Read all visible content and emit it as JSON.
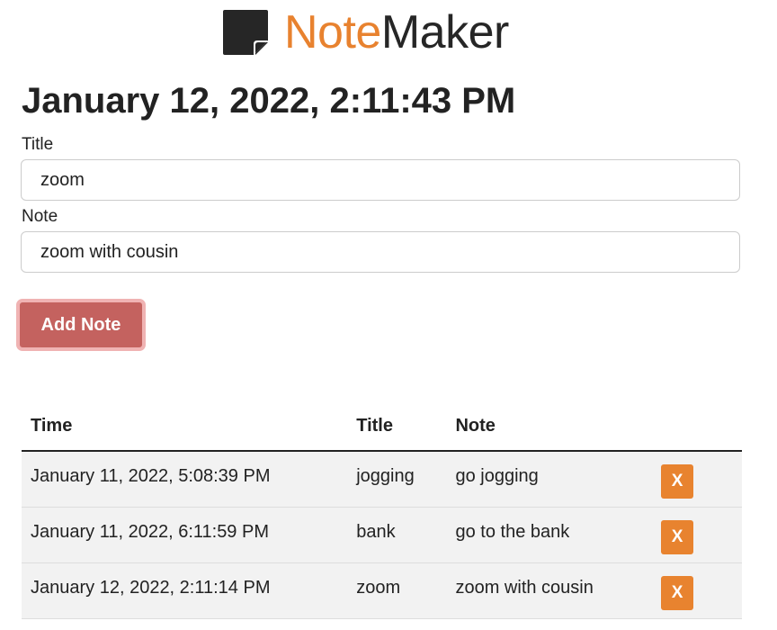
{
  "header": {
    "logo_accent": "Note",
    "logo_main": "Maker",
    "logo_icon": "sticky-note-icon",
    "accent_color": "#e8822f"
  },
  "current_datetime": "January 12, 2022, 2:11:43 PM",
  "form": {
    "title_label": "Title",
    "title_value": "zoom",
    "note_label": "Note",
    "note_value": "zoom with cousin",
    "add_button_label": "Add Note",
    "add_button_color": "#c4625f"
  },
  "table": {
    "headers": {
      "time": "Time",
      "title": "Title",
      "note": "Note"
    },
    "rows": [
      {
        "time": "January 11, 2022, 5:08:39 PM",
        "title": "jogging",
        "note": "go jogging",
        "delete_label": "X"
      },
      {
        "time": "January 11, 2022, 6:11:59 PM",
        "title": "bank",
        "note": "go to the bank",
        "delete_label": "X"
      },
      {
        "time": "January 12, 2022, 2:11:14 PM",
        "title": "zoom",
        "note": "zoom with cousin",
        "delete_label": "X"
      }
    ],
    "delete_button_color": "#e8832f"
  }
}
